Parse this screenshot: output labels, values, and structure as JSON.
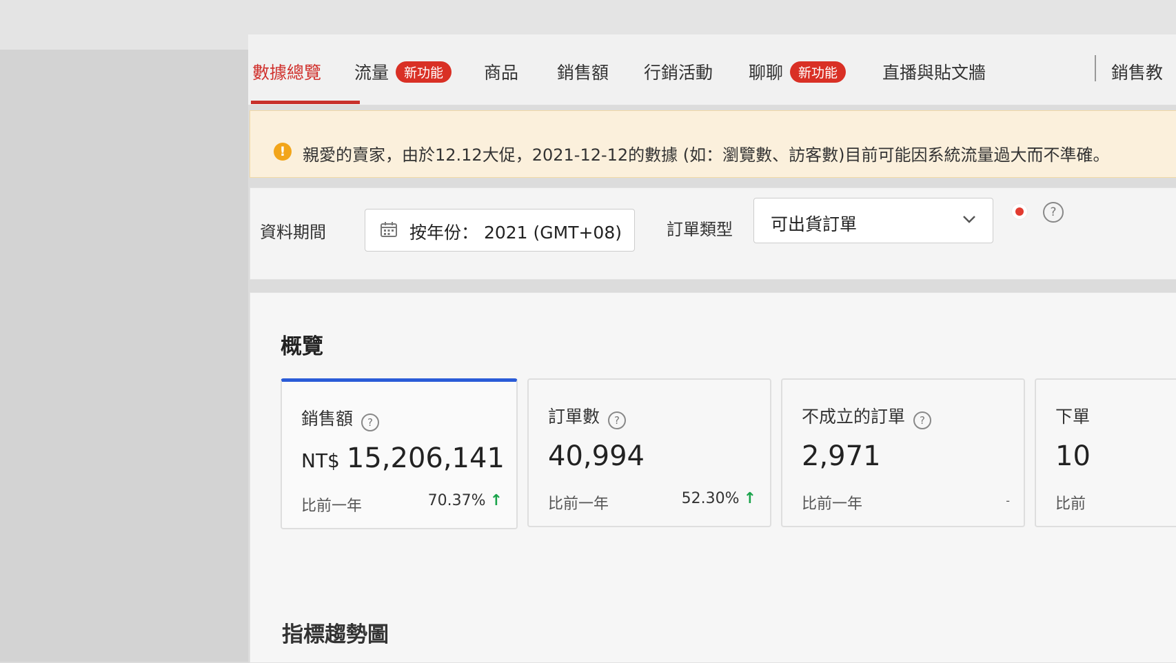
{
  "tabs": [
    {
      "label": "數據總覽",
      "active": true
    },
    {
      "label": "流量",
      "badge": "新功能"
    },
    {
      "label": "商品"
    },
    {
      "label": "銷售額"
    },
    {
      "label": "行銷活動"
    },
    {
      "label": "聊聊",
      "badge": "新功能"
    },
    {
      "label": "直播與貼文牆"
    },
    {
      "label": "銷售教"
    }
  ],
  "notice": {
    "icon": "warning-icon",
    "text": "親愛的賣家，由於12.12大促，2021-12-12的數據 (如：瀏覽數、訪客數)目前可能因系統流量過大而不準確。"
  },
  "filters": {
    "period_label": "資料期間",
    "date_value": "按年份： 2021 (GMT+08)",
    "order_type_label": "訂單類型",
    "order_type_value": "可出貨訂單",
    "help": "?"
  },
  "overview": {
    "title": "概覽",
    "cards": [
      {
        "label": "銷售額",
        "currency": "NT$",
        "value": "15,206,141",
        "compare_label": "比前一年",
        "change": "70.37%",
        "trend": "up",
        "selected": true
      },
      {
        "label": "訂單數",
        "value": "40,994",
        "compare_label": "比前一年",
        "change": "52.30%",
        "trend": "up"
      },
      {
        "label": "不成立的訂單",
        "value": "2,971",
        "compare_label": "比前一年",
        "change": "-"
      },
      {
        "label": "下單",
        "value": "10",
        "compare_label": "比前"
      }
    ]
  },
  "trend": {
    "title": "指標趨勢圖"
  },
  "colors": {
    "accent": "#d0312d",
    "badge": "#d93025",
    "selected_card": "#2a5bd7",
    "up_arrow": "#19a34a",
    "notice_bg": "#fbf0dc"
  }
}
